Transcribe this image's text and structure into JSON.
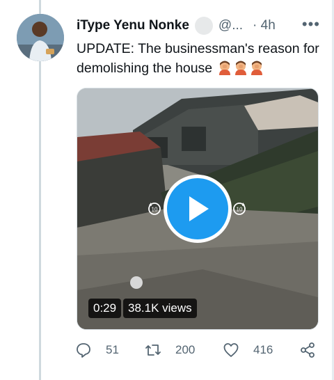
{
  "tweet": {
    "author_name": "iType Yenu Nonke",
    "handle": "@...",
    "time_sep": "·",
    "time": "4h",
    "more_label": "•••",
    "text": "UPDATE: The businessman's reason for demolishing the house",
    "emoji": [
      "person-facepalming",
      "person-facepalming",
      "person-facepalming"
    ],
    "video": {
      "duration": "0:29",
      "views": "38.1K views",
      "controls": [
        "rewind-10-icon",
        "play-icon",
        "forward-10-icon"
      ]
    },
    "actions": {
      "replies": "51",
      "retweets": "200",
      "likes": "416"
    }
  },
  "colors": {
    "accent": "#1d9bf0",
    "text": "#0f1419",
    "secondary": "#536471",
    "thread_line": "#cfd9de"
  }
}
